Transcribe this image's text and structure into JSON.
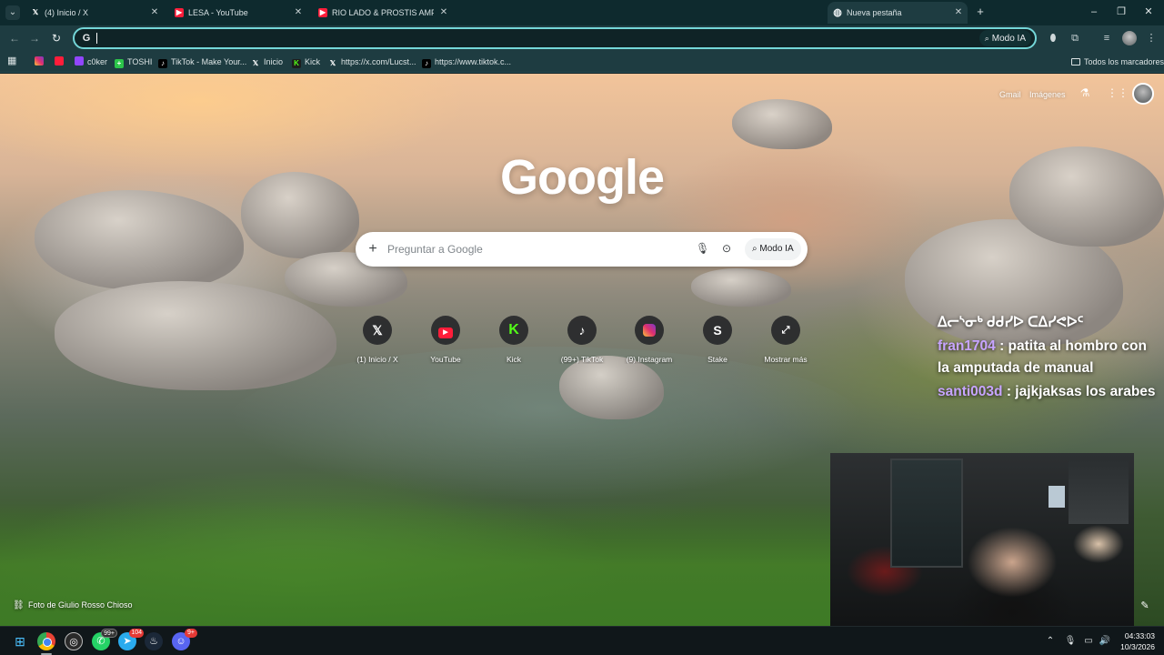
{
  "browser": {
    "tabs": [
      {
        "title": "(4) Inicio / X",
        "favicon": "x-logo-icon"
      },
      {
        "title": "LESA - YouTube",
        "favicon": "youtube-icon"
      },
      {
        "title": "RIO LADO & PROSTIS AMPUTA",
        "favicon": "youtube-icon"
      },
      {
        "title": "Nueva pestaña",
        "favicon": "google-icon",
        "active": true
      }
    ],
    "omnibox": {
      "value": "",
      "modo_ia_label": "Modo IA"
    },
    "bookmarks": [
      {
        "label": "",
        "favicon": "instagram-icon"
      },
      {
        "label": "",
        "favicon": "youtube-icon"
      },
      {
        "label": "c0ker",
        "favicon": "twitch-icon"
      },
      {
        "label": "TOSHI",
        "favicon": "toshi-icon"
      },
      {
        "label": "TikTok - Make Your...",
        "favicon": "tiktok-icon"
      },
      {
        "label": "Inicio",
        "favicon": "x-logo-icon"
      },
      {
        "label": "Kick",
        "favicon": "kick-icon"
      },
      {
        "label": "https://x.com/Lucst...",
        "favicon": "x-logo-icon"
      },
      {
        "label": "https://www.tiktok.c...",
        "favicon": "tiktok-icon"
      }
    ],
    "all_bookmarks_label": "Todos los marcadores"
  },
  "newtab": {
    "top_links": {
      "gmail": "Gmail",
      "images": "Imágenes"
    },
    "logo_text": "Google",
    "search": {
      "placeholder": "Preguntar a Google",
      "modo_ia_label": "Modo IA"
    },
    "shortcuts": [
      {
        "label": "(1) Inicio / X",
        "icon": "x-logo-icon"
      },
      {
        "label": "YouTube",
        "icon": "youtube-icon"
      },
      {
        "label": "Kick",
        "icon": "kick-icon"
      },
      {
        "label": "(99+) TikTok",
        "icon": "tiktok-icon"
      },
      {
        "label": "(9) Instagram",
        "icon": "instagram-icon"
      },
      {
        "label": "Stake",
        "icon": "stake-icon"
      },
      {
        "label": "Mostrar más",
        "icon": "expand-icon"
      }
    ],
    "photo_credit": "Foto de Giulio Rosso Chioso"
  },
  "stream_overlay": {
    "chat": [
      {
        "user": "",
        "message": "ᐃᓕᔅᓂᒃ ᑯᑯᓯᐅ ᑕᐃᓯᕙᐅᑦ"
      },
      {
        "user": "fran1704",
        "message": ": patita al hombro con la amputada de manual"
      },
      {
        "user": "santi003d",
        "message": ": jajkjaksas los arabes"
      }
    ]
  },
  "taskbar": {
    "badges": {
      "whatsapp": "99+",
      "telegram": "104",
      "discord": "9+"
    },
    "time": "04:33:03",
    "date": "10/3/2026"
  }
}
